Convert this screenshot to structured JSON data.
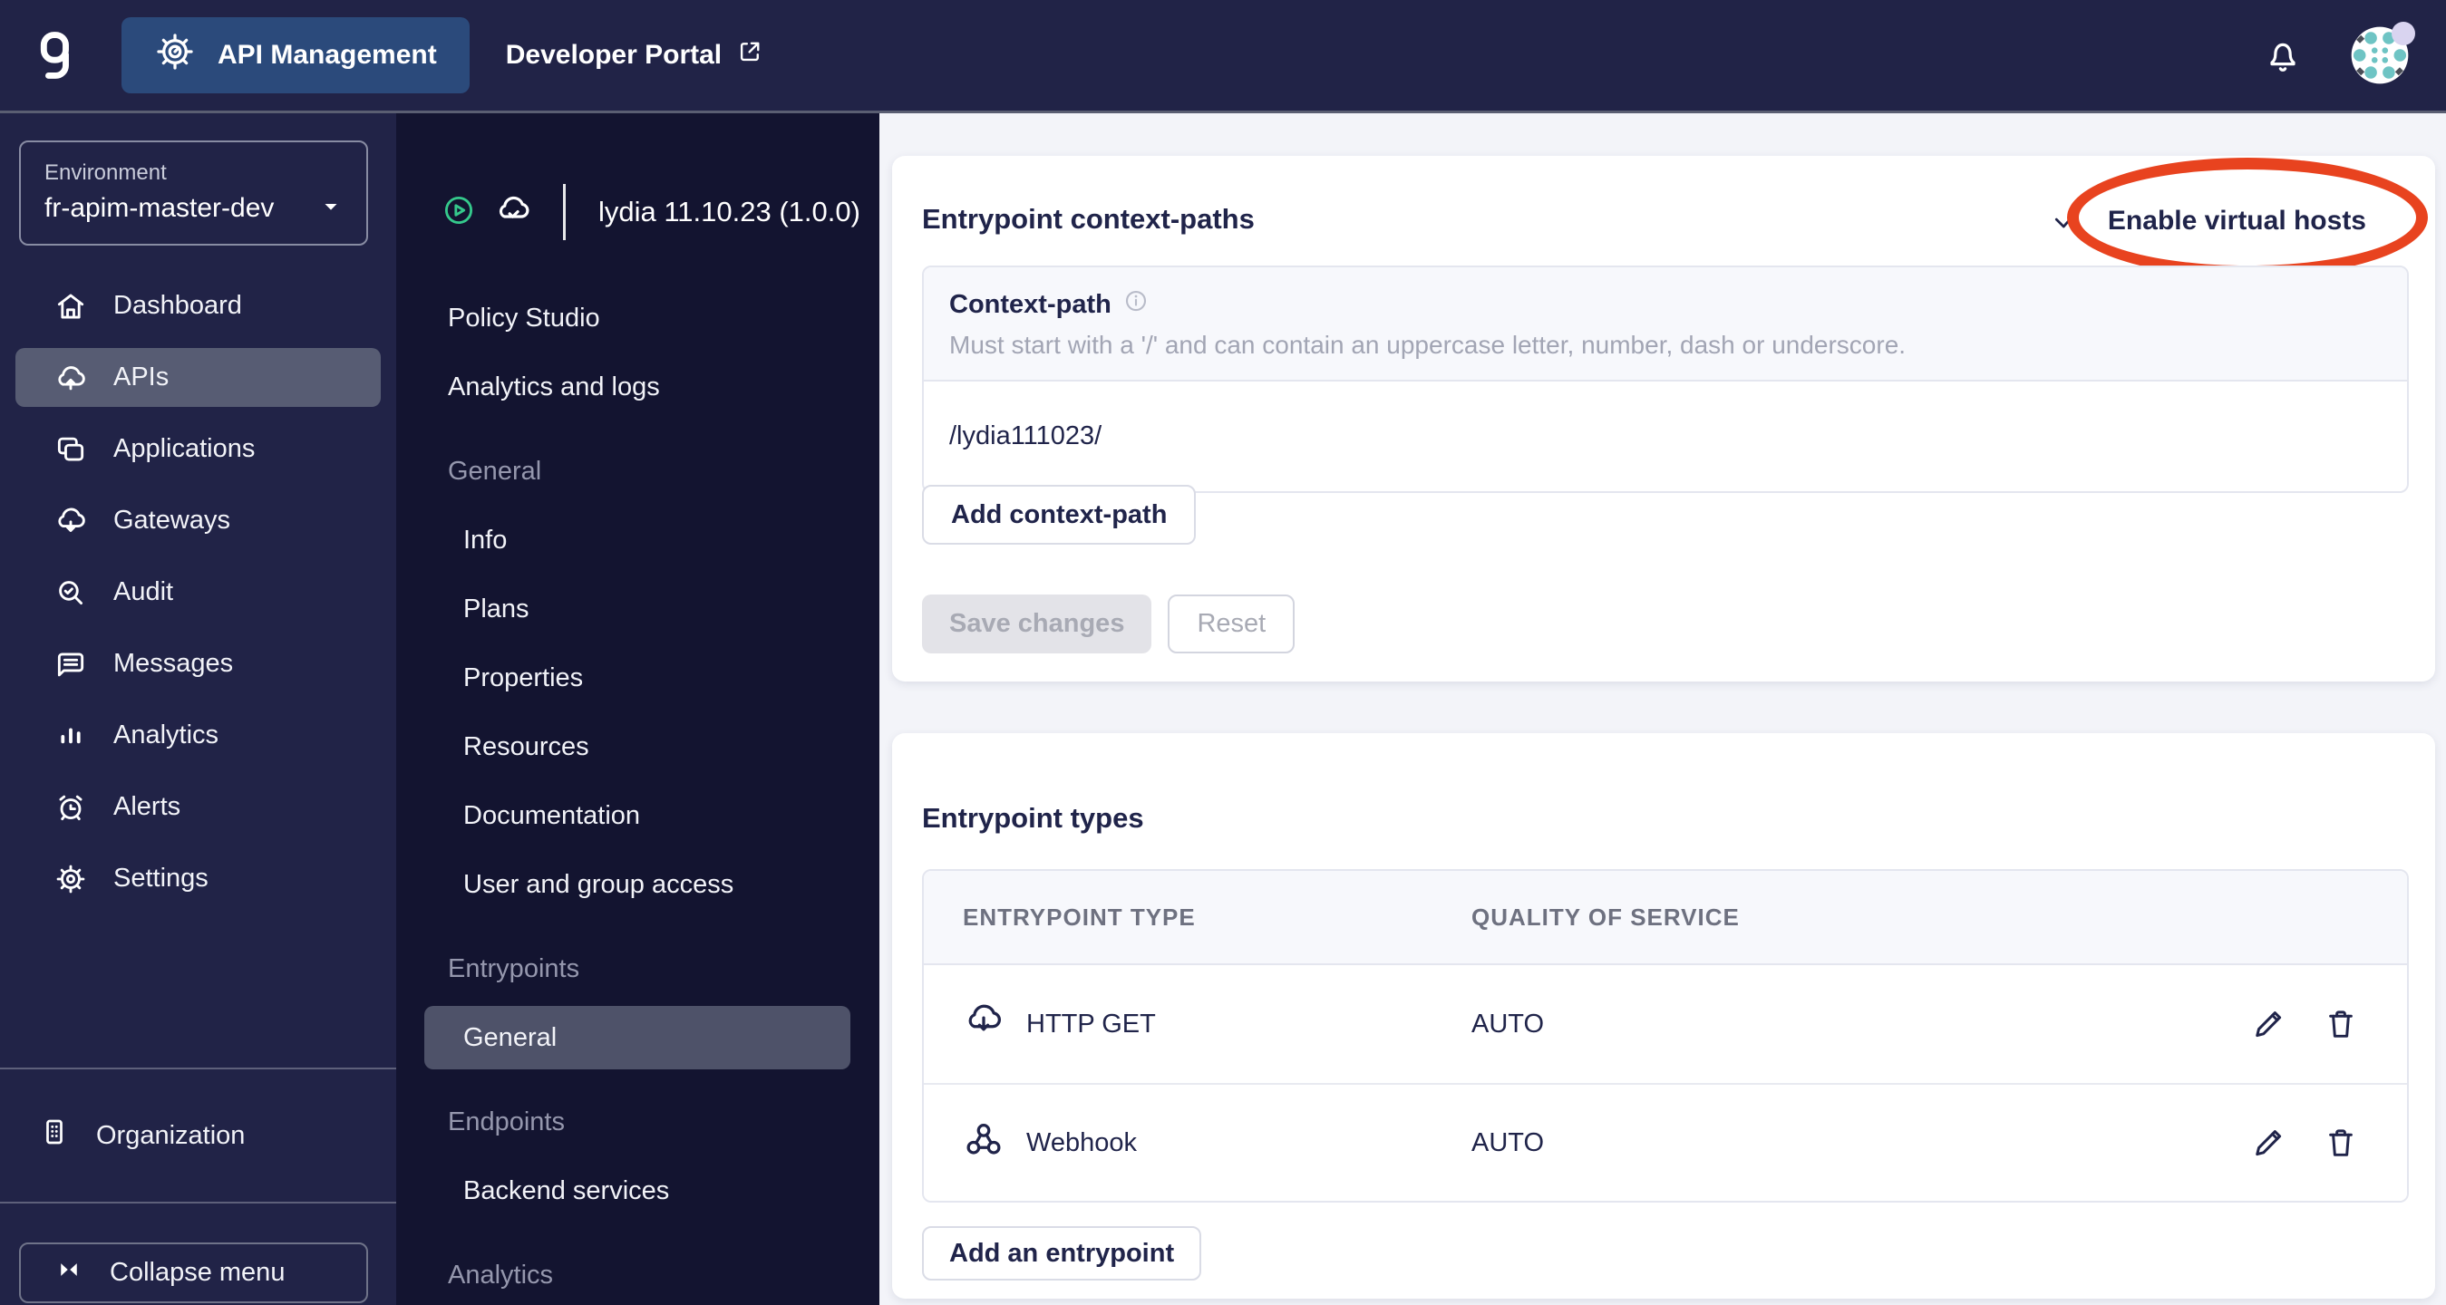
{
  "topbar": {
    "logo_letter": "g",
    "api_management": "API Management",
    "developer_portal": "Developer Portal"
  },
  "sidebar": {
    "environment": {
      "label": "Environment",
      "value": "fr-apim-master-dev"
    },
    "items": [
      {
        "label": "Dashboard"
      },
      {
        "label": "APIs"
      },
      {
        "label": "Applications"
      },
      {
        "label": "Gateways"
      },
      {
        "label": "Audit"
      },
      {
        "label": "Messages"
      },
      {
        "label": "Analytics"
      },
      {
        "label": "Alerts"
      },
      {
        "label": "Settings"
      }
    ],
    "organization": "Organization",
    "collapse": "Collapse menu"
  },
  "api_menu": {
    "title": "lydia 11.10.23 (1.0.0)",
    "items": [
      {
        "label": "Policy Studio"
      },
      {
        "label": "Analytics and logs"
      }
    ],
    "general_section": {
      "label": "General",
      "items": [
        {
          "label": "Info"
        },
        {
          "label": "Plans"
        },
        {
          "label": "Properties"
        },
        {
          "label": "Resources"
        },
        {
          "label": "Documentation"
        },
        {
          "label": "User and group access"
        }
      ]
    },
    "entrypoints_section": {
      "label": "Entrypoints",
      "items": [
        {
          "label": "General"
        }
      ]
    },
    "endpoints_section": {
      "label": "Endpoints",
      "items": [
        {
          "label": "Backend services"
        }
      ]
    },
    "analytics_section": {
      "label": "Analytics"
    }
  },
  "main": {
    "context_paths_card": {
      "title": "Entrypoint context-paths",
      "enable_virtual_hosts": "Enable virtual hosts",
      "context_path": {
        "label": "Context-path",
        "hint": "Must start with a '/' and can contain an uppercase letter, number, dash or underscore.",
        "value": "/lydia111023/"
      },
      "add_context_path": "Add context-path",
      "save_changes": "Save changes",
      "reset": "Reset"
    },
    "entrypoint_types_card": {
      "title": "Entrypoint types",
      "columns": [
        "ENTRYPOINT TYPE",
        "QUALITY OF SERVICE"
      ],
      "rows": [
        {
          "type": "HTTP GET",
          "qos": "AUTO"
        },
        {
          "type": "Webhook",
          "qos": "AUTO"
        }
      ],
      "add_entrypoint": "Add an entrypoint"
    }
  },
  "colors": {
    "annotation_red": "#E8431F",
    "brand_navy": "#212347",
    "panel_dark": "#131430",
    "selected_item": "#575C73",
    "accent_blue": "#2B4A7B",
    "status_green": "#35C98C",
    "avatar_teal": "#6EC4C4"
  }
}
